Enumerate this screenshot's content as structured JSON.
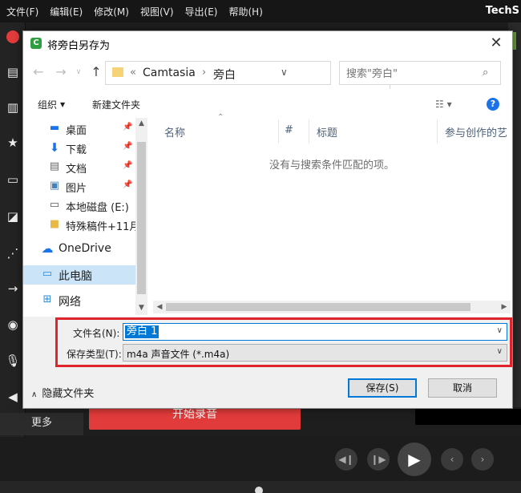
{
  "app": {
    "menu": [
      "文件(F)",
      "编辑(E)",
      "修改(M)",
      "视图(V)",
      "导出(E)",
      "帮助(H)"
    ],
    "brand": "TechS",
    "more_tab": "更多",
    "start_record": "开始录音"
  },
  "dialog": {
    "title": "将旁白另存为",
    "close_glyph": "✕",
    "address": {
      "prefix": "«",
      "parts": [
        "Camtasia",
        "旁白"
      ],
      "separator": "›"
    },
    "search_placeholder": "搜索\"旁白\"",
    "toolbar": {
      "organize": "组织",
      "new_folder": "新建文件夹"
    },
    "nav_items": [
      {
        "label": "桌面",
        "icon": "desktop-icon",
        "pinned": true
      },
      {
        "label": "下载",
        "icon": "download-icon",
        "pinned": true
      },
      {
        "label": "文档",
        "icon": "document-icon",
        "pinned": true
      },
      {
        "label": "图片",
        "icon": "picture-icon",
        "pinned": true
      },
      {
        "label": "本地磁盘 (E:)",
        "icon": "drive-icon",
        "pinned": false
      },
      {
        "label": "特殊稿件+11月",
        "icon": "folder-icon",
        "pinned": false
      },
      {
        "label": "OneDrive",
        "icon": "cloud-icon",
        "pinned": false
      },
      {
        "label": "此电脑",
        "icon": "computer-icon",
        "pinned": false,
        "selected": true
      },
      {
        "label": "网络",
        "icon": "network-icon",
        "pinned": false
      }
    ],
    "columns": [
      "名称",
      "#",
      "标题",
      "参与创作的艺"
    ],
    "empty_message": "没有与搜索条件匹配的项。",
    "filename_label": "文件名(N):",
    "filename_value": "旁白 1",
    "filetype_label": "保存类型(T):",
    "filetype_value": "m4a 声音文件 (*.m4a)",
    "hide_folders": "隐藏文件夹",
    "save_button": "保存(S)",
    "cancel_button": "取消"
  },
  "colors": {
    "highlight": "#e0242e",
    "accent": "#0078d7",
    "record": "#e23b3b",
    "selected_nav": "#cce4f7"
  }
}
